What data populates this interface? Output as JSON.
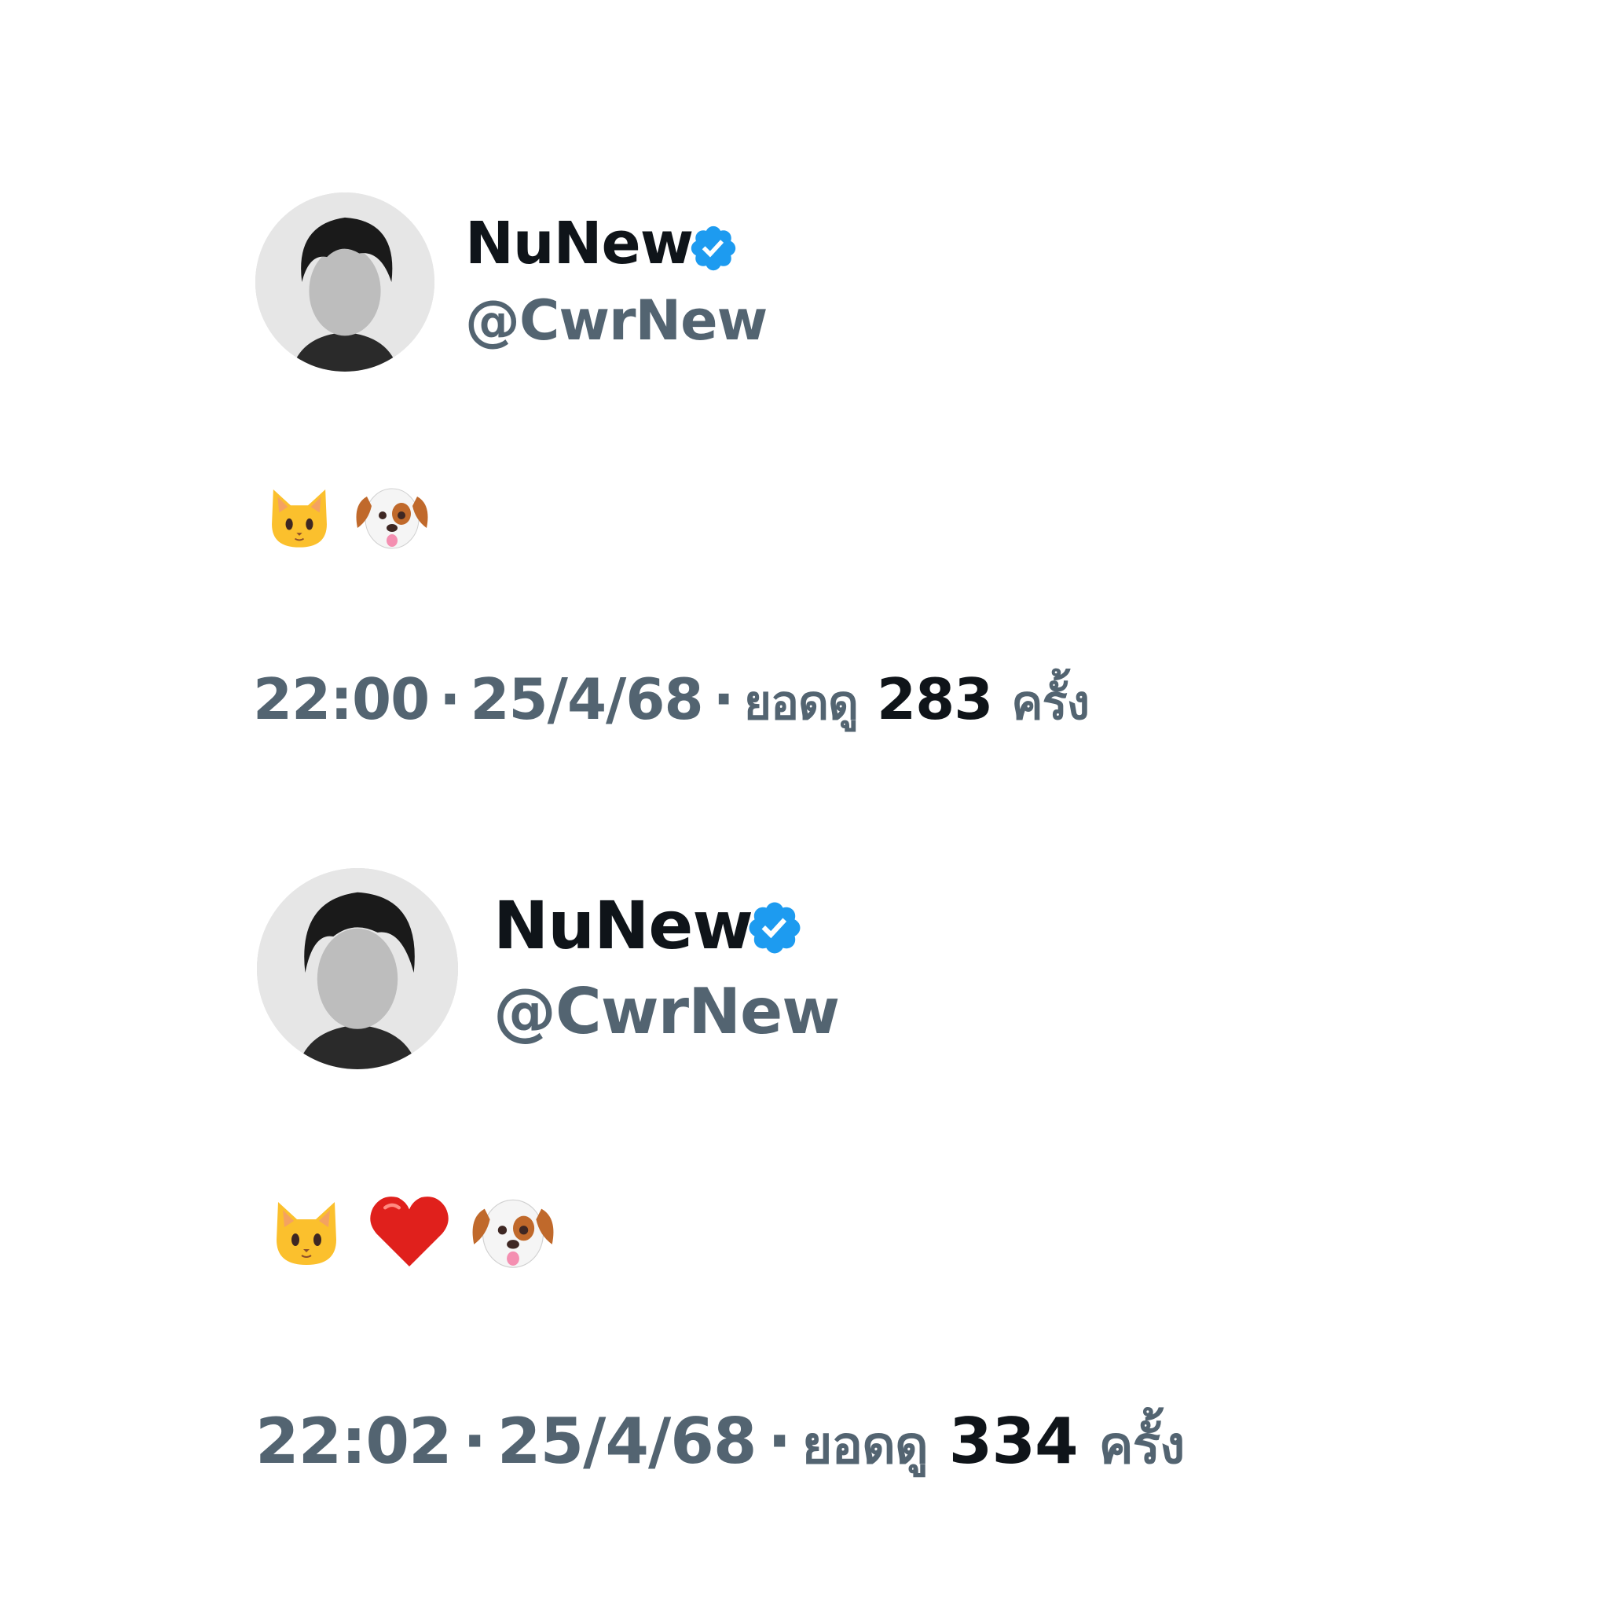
{
  "tweets": [
    {
      "display_name": "NuNew",
      "handle": "@CwrNew",
      "verified": true,
      "emojis": [
        "cat-face",
        "dog-face"
      ],
      "time": "22:00",
      "date": "25/4/68",
      "views_label": "ยอดดู",
      "views_count": "283",
      "views_suffix": "ครั้ง"
    },
    {
      "display_name": "NuNew",
      "handle": "@CwrNew",
      "verified": true,
      "emojis": [
        "cat-face",
        "red-heart",
        "dog-face"
      ],
      "time": "22:02",
      "date": "25/4/68",
      "views_label": "ยอดดู",
      "views_count": "334",
      "views_suffix": "ครั้ง"
    }
  ],
  "separator": "·",
  "colors": {
    "name": "#0f1419",
    "secondary": "#536471",
    "verified": "#1d9bf0"
  }
}
